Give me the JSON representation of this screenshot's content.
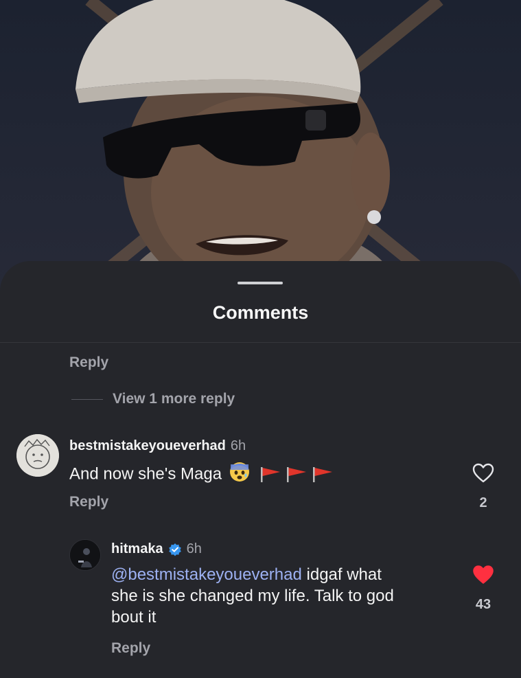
{
  "sheet": {
    "title": "Comments"
  },
  "thread_top": {
    "reply_label": "Reply",
    "view_more_label": "View 1 more reply"
  },
  "comments": [
    {
      "username": "bestmistakeyoueverhad",
      "time": "6h",
      "text": "And now she's Maga",
      "emoji": "anxious-face-emoji",
      "flags": 3,
      "likes": "2",
      "liked": false,
      "reply_label": "Reply"
    },
    {
      "username": "hitmaka",
      "verified": true,
      "time": "6h",
      "mention": "@bestmistakeyoueverhad",
      "text_line1": " idgaf what",
      "text_line2": "she is she changed my life. Talk to god",
      "text_line3": "bout it",
      "likes": "43",
      "liked": true,
      "reply_label": "Reply"
    }
  ],
  "colors": {
    "sheet_bg": "#25262b",
    "muted_text": "#a3a4ab",
    "mention": "#9db1f2",
    "liked_heart": "#ff3040",
    "verified": "#3897f0",
    "flag": "#e0352b"
  }
}
